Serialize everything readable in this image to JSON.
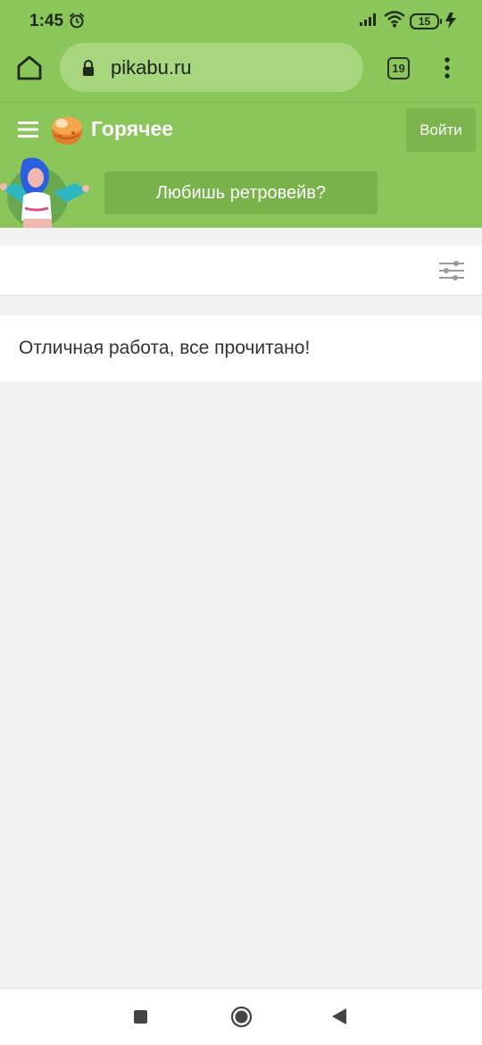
{
  "status_bar": {
    "time": "1:45",
    "battery": "15",
    "icons": [
      "alarm-icon",
      "signal-icon",
      "wifi-icon",
      "battery-icon",
      "charging-icon"
    ]
  },
  "browser": {
    "url": "pikabu.ru",
    "tab_count": "19",
    "icons": [
      "home-icon",
      "lock-icon",
      "tabs-icon",
      "more-vert-icon"
    ]
  },
  "site_header": {
    "section_title": "Горячее",
    "login_label": "Войти",
    "promo_label": "Любишь ретровейв?",
    "icons": [
      "hamburger-icon",
      "pikabu-logo-icon"
    ]
  },
  "content": {
    "message": "Отличная работа, все прочитано!",
    "icons": [
      "filter-sliders-icon"
    ]
  },
  "colors": {
    "brand_green": "#8bc65a",
    "url_bar": "#a8d67f",
    "button_green": "#79b24b",
    "page_bg": "#f2f2f2"
  },
  "nav_bar": {
    "icons": [
      "recents-icon",
      "home-circle-icon",
      "back-icon"
    ]
  }
}
